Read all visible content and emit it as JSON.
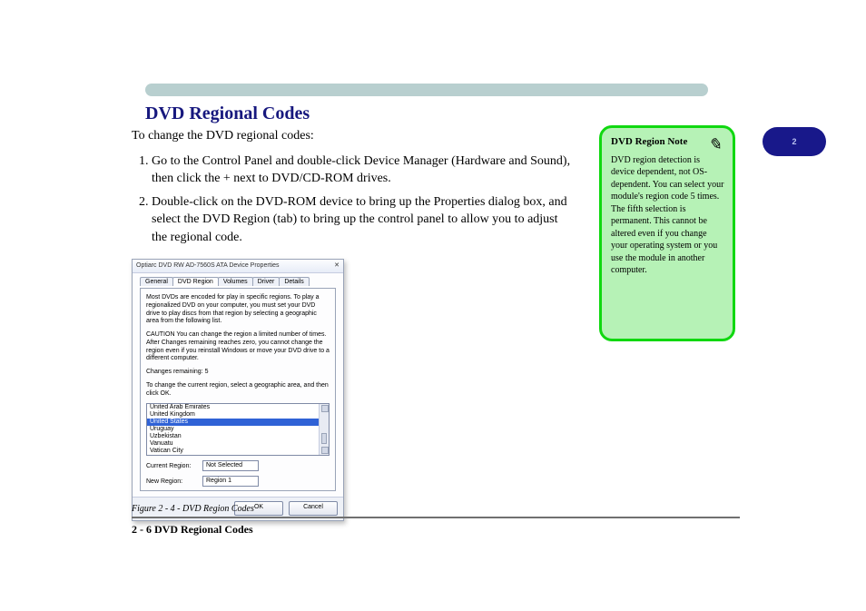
{
  "header": {
    "section_title": "DVD Regional Codes",
    "side_pill": "2"
  },
  "body": {
    "p1": "To change the DVD regional codes:",
    "steps": [
      "Go to the Control Panel and double-click Device Manager (Hardware and Sound), then click the + next to DVD/CD-ROM drives.",
      "Double-click on the DVD-ROM device to bring up the Properties dialog box, and select the DVD Region (tab) to bring up the control panel to allow you to adjust the regional code."
    ],
    "p2": "DVD region detection is device dependent, not OS-dependent. You can select your module's region code 5 times. The fifth selection is permanent. This cannot be altered even if you change your operating system or if you use the module in another computer."
  },
  "note": {
    "title": "DVD Region Note",
    "p1": "DVD region detection is device dependent, not OS-dependent. You can select your module's region code 5 times. The fifth selection is permanent. This cannot be altered even if you change your operating system or you use the module in another computer."
  },
  "dialog": {
    "title": "Optiarc DVD RW AD-7560S ATA Device Properties",
    "tabs": [
      "General",
      "DVD Region",
      "Volumes",
      "Driver",
      "Details"
    ],
    "active_tab": 1,
    "intro": "Most DVDs are encoded for play in specific regions. To play a regionalized DVD on your computer, you must set your DVD drive to play discs from that region by selecting a geographic area from the following list.",
    "caution": "CAUTION   You can change the region a limited number of times. After Changes remaining reaches zero, you cannot change the region even if you reinstall Windows or move your DVD drive to a different computer.",
    "changes_remaining_label": "Changes remaining: 5",
    "change_instr": "To change the current region, select a geographic area, and then click OK.",
    "list": {
      "items": [
        "United Arab Emirates",
        "United Kingdom",
        "United States",
        "Uruguay",
        "Uzbekistan",
        "Vanuatu",
        "Vatican City"
      ],
      "selected_index": 2
    },
    "current_region_label": "Current Region:",
    "current_region_value": "Not Selected",
    "new_region_label": "New Region:",
    "new_region_value": "Region 1",
    "ok": "OK",
    "cancel": "Cancel"
  },
  "figure_caption": "Figure 2 - 4 - DVD Region Codes",
  "page_number": "2 - 6  DVD Regional Codes"
}
